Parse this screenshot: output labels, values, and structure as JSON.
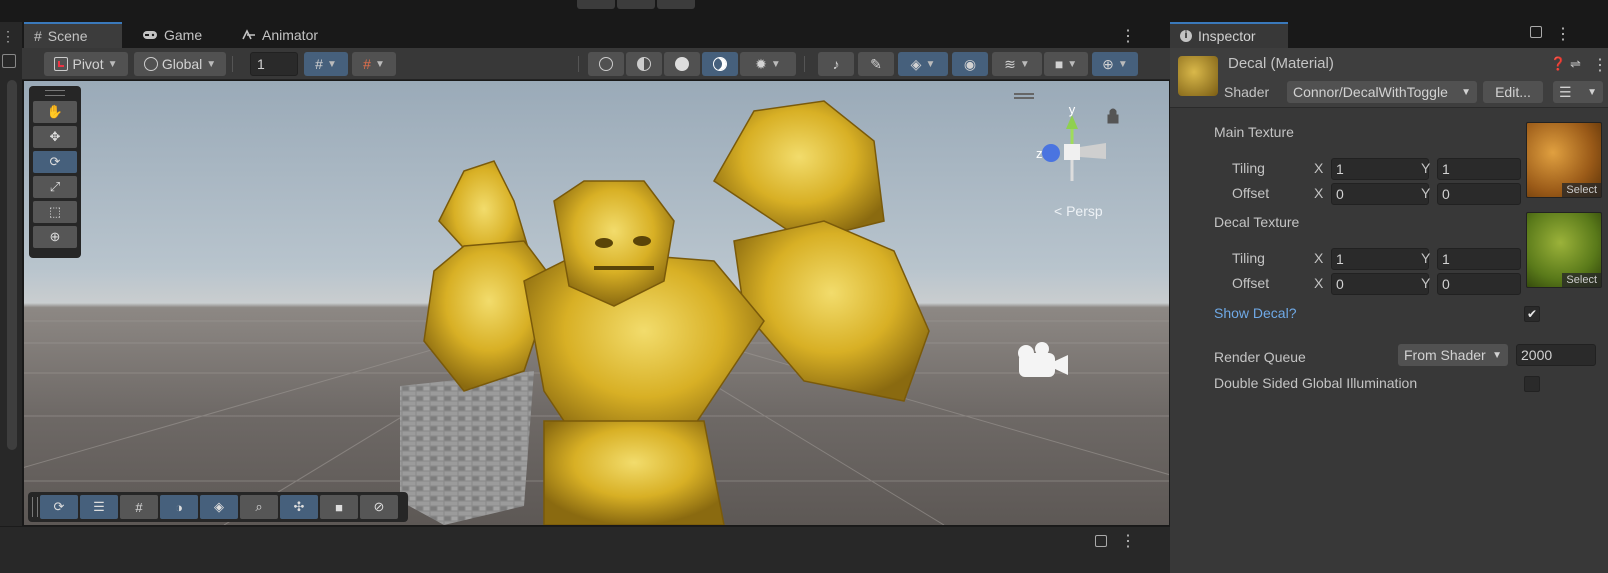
{
  "colors": {
    "accent": "#3a79bb",
    "link": "#6fa9e6",
    "selected_tool": "#46607c",
    "gold": "#d4b01c"
  },
  "tabs": [
    {
      "label": "Scene",
      "icon": "grid-icon"
    },
    {
      "label": "Game",
      "icon": "gamepad-icon"
    },
    {
      "label": "Animator",
      "icon": "animator-icon"
    }
  ],
  "scene_toolbar": {
    "pivot_label": "Pivot",
    "global_label": "Global",
    "grid_size": "1"
  },
  "gizmo": {
    "y_label": "y",
    "z_label": "z",
    "projection": "Persp"
  },
  "inspector": {
    "tab_label": "Inspector",
    "material_title": "Decal (Material)",
    "shader_label": "Shader",
    "shader_value": "Connor/DecalWithToggle",
    "edit_label": "Edit...",
    "main_texture": {
      "label": "Main Texture",
      "tiling_label": "Tiling",
      "offset_label": "Offset",
      "tiling_x": "1",
      "tiling_y": "1",
      "offset_x": "0",
      "offset_y": "0",
      "select_label": "Select"
    },
    "decal_texture": {
      "label": "Decal Texture",
      "tiling_label": "Tiling",
      "offset_label": "Offset",
      "tiling_x": "1",
      "tiling_y": "1",
      "offset_x": "0",
      "offset_y": "0",
      "select_label": "Select"
    },
    "x_label": "X",
    "y_label": "Y",
    "show_decal_label": "Show Decal?",
    "show_decal_checked": true,
    "render_queue_label": "Render Queue",
    "render_queue_mode": "From Shader",
    "render_queue_value": "2000",
    "double_sided_label": "Double Sided Global Illumination",
    "double_sided_checked": false
  }
}
